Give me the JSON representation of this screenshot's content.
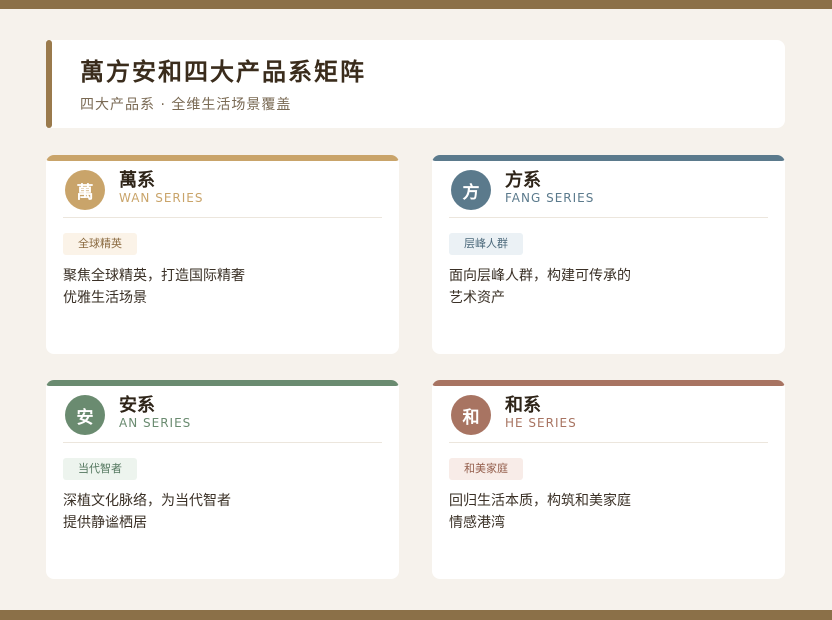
{
  "header": {
    "title": "萬方安和四大产品系矩阵",
    "subtitle": "四大产品系 · 全维生活场景覆盖"
  },
  "cards": [
    {
      "icon_char": "萬",
      "name": "萬系",
      "series": "WAN SERIES",
      "tag": "全球精英",
      "desc_line1": "聚焦全球精英，打造国际精奢",
      "desc_line2": "优雅生活场景",
      "accent": "#c9a46a",
      "tag_bg": "#fbf3e8",
      "tag_color": "#8a6a40"
    },
    {
      "icon_char": "方",
      "name": "方系",
      "series": "FANG SERIES",
      "tag": "层峰人群",
      "desc_line1": "面向层峰人群，构建可传承的",
      "desc_line2": "艺术资产",
      "accent": "#5b7a8c",
      "tag_bg": "#ebf1f5",
      "tag_color": "#4d6a7c"
    },
    {
      "icon_char": "安",
      "name": "安系",
      "series": "AN SERIES",
      "tag": "当代智者",
      "desc_line1": "深植文化脉络，为当代智者",
      "desc_line2": "提供静谧栖居",
      "accent": "#6a8b70",
      "tag_bg": "#edf4ee",
      "tag_color": "#557860"
    },
    {
      "icon_char": "和",
      "name": "和系",
      "series": "HE SERIES",
      "tag": "和美家庭",
      "desc_line1": "回归生活本质，构筑和美家庭",
      "desc_line2": "情感港湾",
      "accent": "#a87462",
      "tag_bg": "#f8ece8",
      "tag_color": "#945e4c"
    }
  ]
}
